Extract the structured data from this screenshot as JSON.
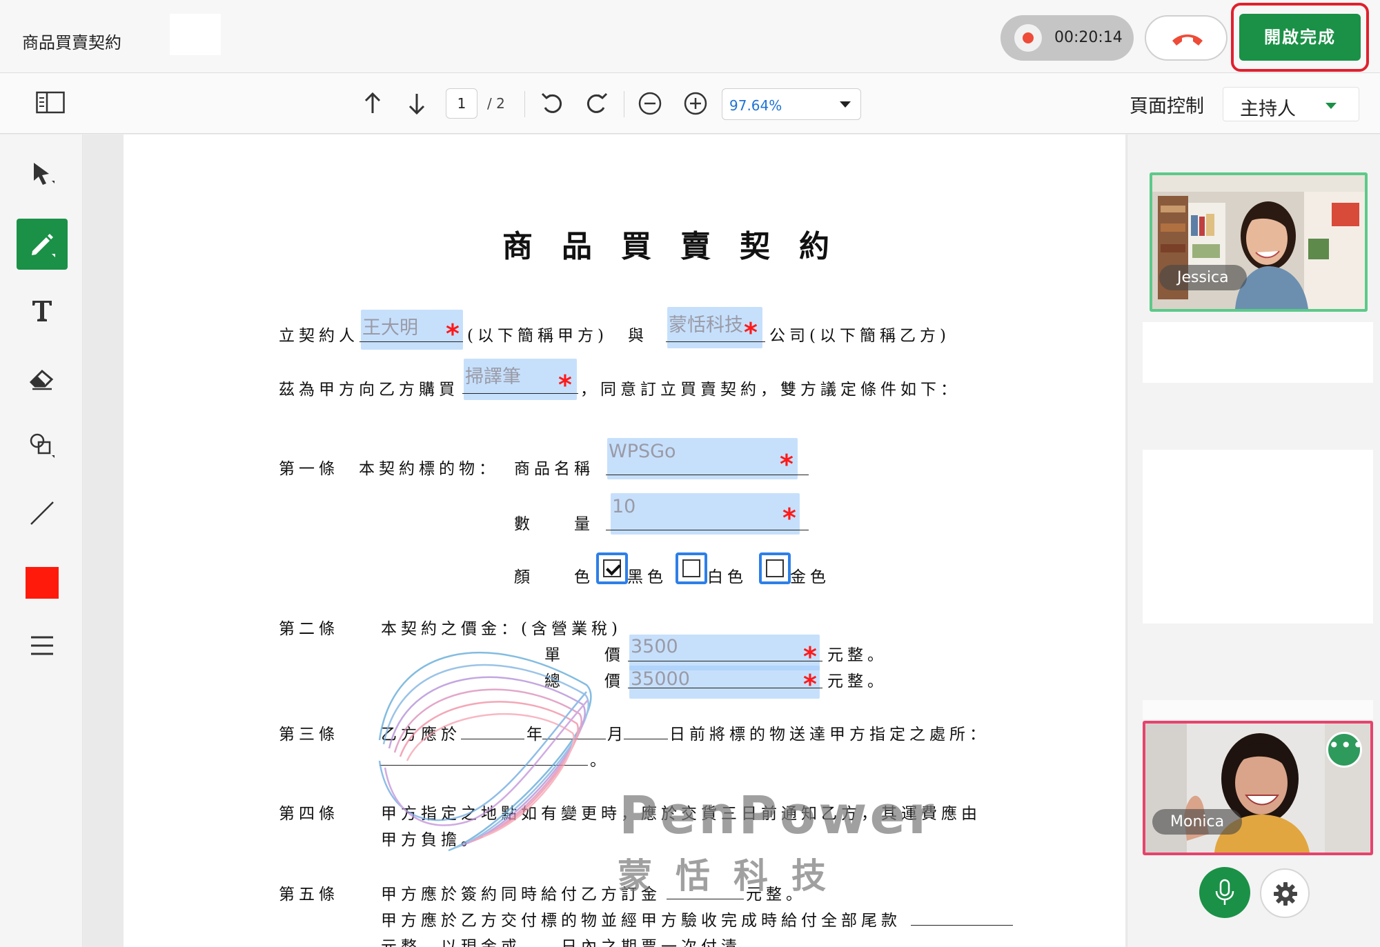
{
  "header": {
    "doc_title": "商品買賣契約",
    "timer": "00:20:14",
    "finish_label": "開啟完成"
  },
  "toolbar": {
    "page_current": "1",
    "page_total": "/ 2",
    "zoom": "97.64%",
    "page_control_label": "頁面控制",
    "role": "主持人"
  },
  "tools": [
    "select-tool",
    "pen-tool",
    "text-tool",
    "eraser-tool",
    "shape-tool",
    "line-tool",
    "color-swatch",
    "menu"
  ],
  "active_color": "#ff1a0c",
  "document": {
    "title": "商品買賣契約",
    "l1_prefix": "立契約人",
    "l1_mid": "(以下簡稱甲方)　與",
    "l1_suffix": "公司(以下簡稱乙方)",
    "l2_prefix": "茲為甲方向乙方購買",
    "l2_suffix": "，同意訂立買賣契約，雙方議定條件如下：",
    "a1_label": "第一條　本契約標的物：",
    "a1_product_label": "商品名稱",
    "a1_qty_label": "數　　量",
    "a1_color_label": "顏　　色",
    "color_options": [
      "黑色",
      "白色",
      "金色"
    ],
    "color_checked": [
      true,
      false,
      false
    ],
    "a2_label": "第二條",
    "a2_text": "本契約之價金：(含營業稅)",
    "unit_price_label": "單　　價",
    "total_price_label": "總　　價",
    "yuan_suffix": "元整。",
    "a3_label": "第三條",
    "a3_p1": "乙方應於",
    "a3_year": "年",
    "a3_month": "月",
    "a3_p2": "日前將標的物送達甲方指定之處所：",
    "a3_end": "。",
    "a4_label": "第四條",
    "a4_l1": "甲方指定之地點如有變更時，應於交貨三日前通知乙方，其運費應由",
    "a4_l2": "甲方負擔。",
    "a5_label": "第五條",
    "a5_l1a": "甲方應於簽約同時給付乙方訂金",
    "a5_l1b": "元整。",
    "a5_l2": "甲方應於乙方交付標的物並經甲方驗收完成時給付全部尾款",
    "a5_l3": "元整，以現金或　　日內之期票一次付清。"
  },
  "fields": {
    "party_a": "王大明",
    "party_b": "蒙恬科技",
    "item": "掃譯筆",
    "product_name": "WPSGo",
    "quantity": "10",
    "unit_price": "3500",
    "total_price": "35000"
  },
  "watermark": {
    "name": "PenPower",
    "sub": "蒙恬科技"
  },
  "participants": [
    {
      "name": "Jessica"
    },
    {
      "name": "Monica"
    }
  ],
  "colors": {
    "brand_green": "#1a9147",
    "highlight_red": "#e0202e",
    "field_blue": "#a3cdfa"
  }
}
